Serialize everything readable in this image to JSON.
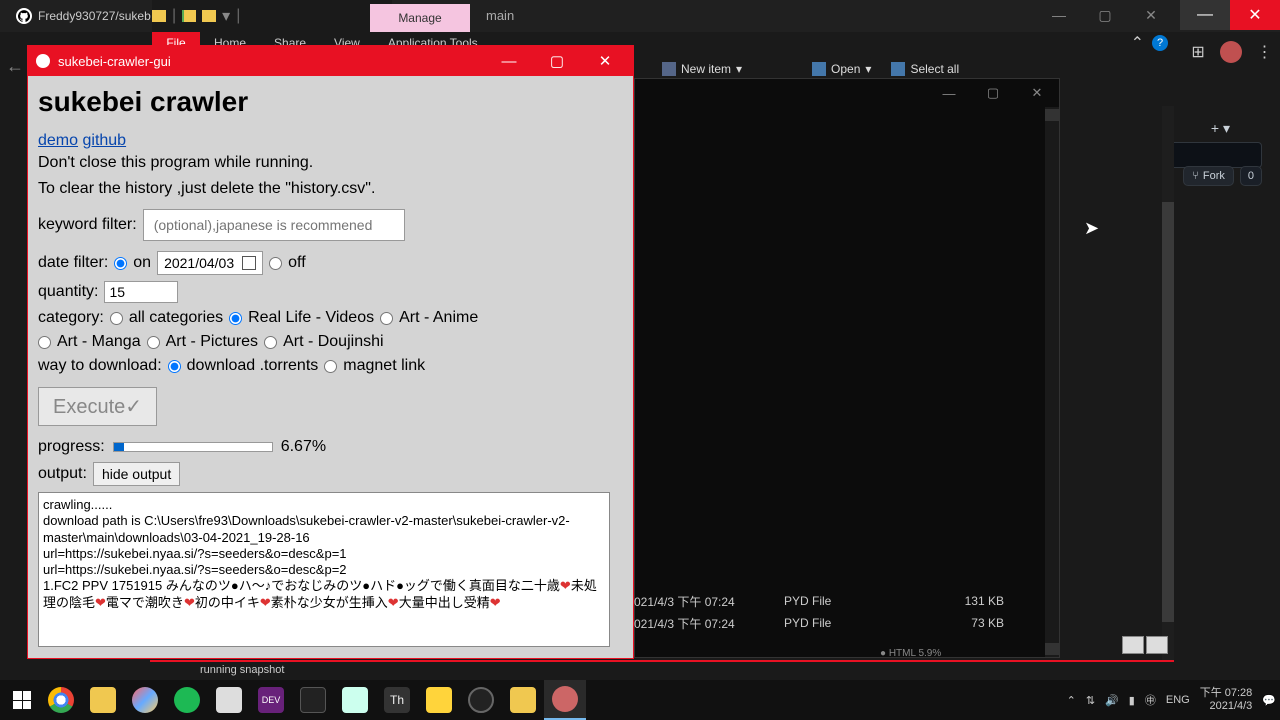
{
  "browser": {
    "tab_title": "Freddy930727/sukeb"
  },
  "explorer": {
    "manage_tab": "Manage",
    "main_label": "main",
    "file_menu": "File",
    "tabs": [
      "Home",
      "Share",
      "View"
    ],
    "tool_tab": "Application Tools",
    "new_item": "New item",
    "open": "Open",
    "select_all": "Select all",
    "snapshot": "running snapshot",
    "html_badge": "HTML 5.9%"
  },
  "github": {
    "fork_label": "Fork",
    "fork_count": "0"
  },
  "files": {
    "rows": [
      {
        "date": "021/4/3 下午 07:24",
        "type": "PYD File",
        "size": "131 KB"
      },
      {
        "date": "021/4/3 下午 07:24",
        "type": "PYD File",
        "size": "73 KB"
      }
    ]
  },
  "crawler": {
    "window_title": "sukebei-crawler-gui",
    "heading": "sukebei crawler",
    "link_demo": "demo",
    "link_github": "github",
    "info1": "Don't close this program while running.",
    "info2": "To clear the history ,just delete the \"history.csv\".",
    "keyword_label": "keyword filter:",
    "keyword_placeholder": "(optional),japanese is recommened",
    "date_label": "date filter:",
    "date_on": "on",
    "date_value": "2021/04/03",
    "date_off": "off",
    "quantity_label": "quantity:",
    "quantity_value": "15",
    "category_label": "category:",
    "cat_all": "all categories",
    "cat_real": "Real Life - Videos",
    "cat_anime": "Art - Anime",
    "cat_manga": "Art - Manga",
    "cat_pictures": "Art - Pictures",
    "cat_doujin": "Art - Doujinshi",
    "download_label": "way to download:",
    "dl_torrents": "download .torrents",
    "dl_magnet": "magnet link",
    "execute_label": "Execute✓",
    "progress_label": "progress:",
    "progress_pct": "6.67%",
    "output_label": "output:",
    "hide_output": "hide output",
    "out_line1": "crawling......",
    "out_line2": "download path is C:\\Users\\fre93\\Downloads\\sukebei-crawler-v2-master\\sukebei-crawler-v2-master\\main\\downloads\\03-04-2021_19-28-16",
    "out_line3": "url=https://sukebei.nyaa.si/?s=seeders&o=desc&p=1",
    "out_line4": "url=https://sukebei.nyaa.si/?s=seeders&o=desc&p=2",
    "out_line5a": "1.FC2 PPV 1751915 みんなのツ●ハ〜♪でおなじみのツ●ハド●ッグで働く真面目な二十歳",
    "out_line5b": "未処理の陰毛",
    "out_line5c": "電マで潮吹き",
    "out_line5d": "初の中イキ",
    "out_line5e": "素朴な少女が生挿入",
    "out_line5f": "大量中出し受精"
  },
  "tray": {
    "lang": "ENG",
    "time": "下午 07:28",
    "date": "2021/4/3"
  }
}
